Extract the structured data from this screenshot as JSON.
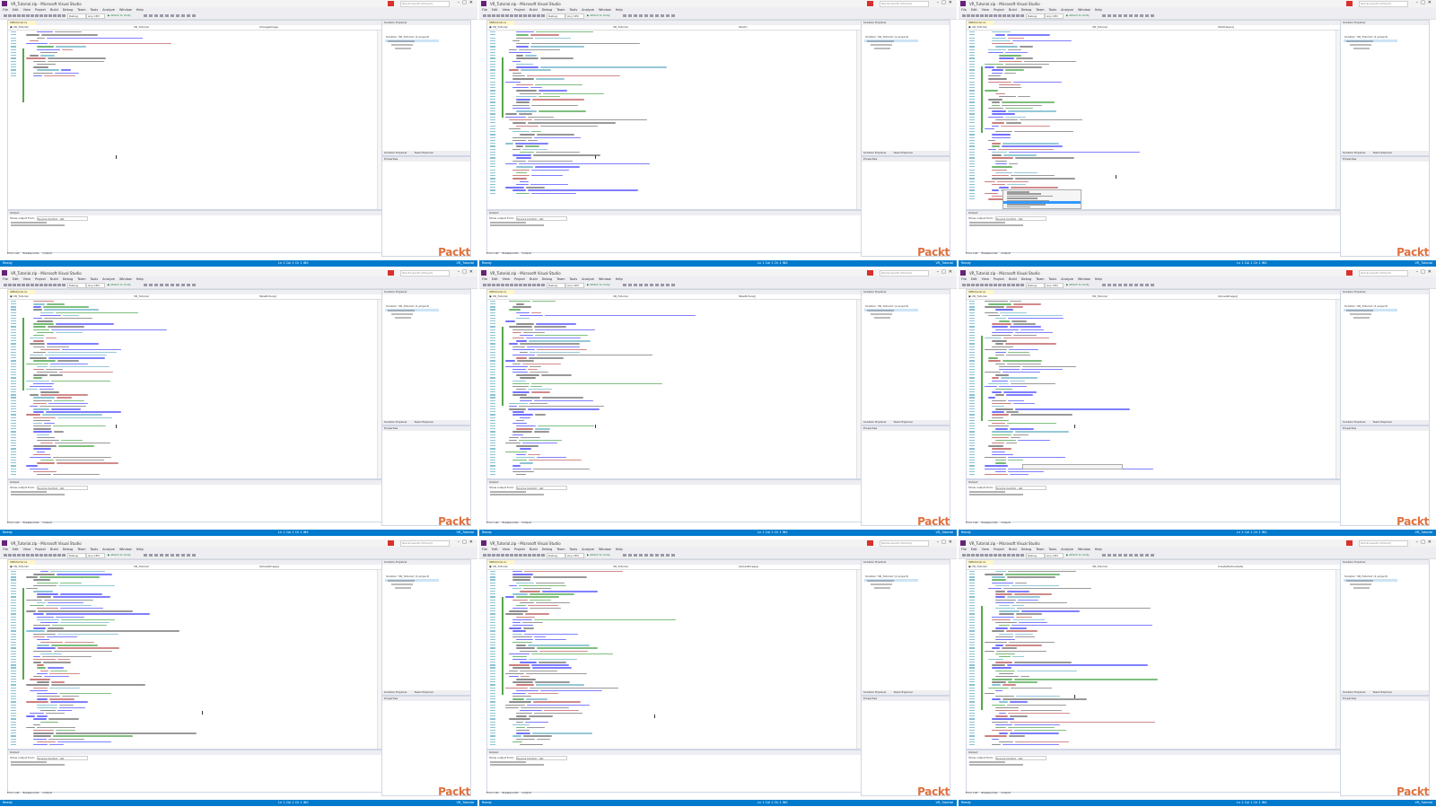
{
  "tiles": [
    {
      "title": "VR_Tutorial.zip - Microsoft Visual Studio",
      "tab": "VRTutorial.cs",
      "nav_class": "VR_Tutorial",
      "nav_member": "ChangeImage",
      "lines": 16
    },
    {
      "title": "VR_Tutorial.zip - Microsoft Visual Studio",
      "tab": "VRTutorial.cs",
      "nav_class": "VR_Tutorial",
      "nav_member": "Start()",
      "lines": 56
    },
    {
      "title": "VR_Tutorial.zip - Microsoft Visual Studio",
      "tab": "VRTutorial.cs",
      "nav_class": "VR_Tutorial",
      "nav_member": "StartUsers()",
      "lines": 58
    },
    {
      "title": "VR_Tutorial.zip - Microsoft Visual Studio",
      "tab": "VRTutorial.cs",
      "nav_class": "VR_Tutorial",
      "nav_member": "TakePicture()",
      "lines": 62
    },
    {
      "title": "VR_Tutorial.zip - Microsoft Visual Studio",
      "tab": "VRTutorial.cs",
      "nav_class": "VR_Tutorial",
      "nav_member": "TakePicture()",
      "lines": 62
    },
    {
      "title": "VR_Tutorial.zip - Microsoft Visual Studio",
      "tab": "VRTutorial.cs",
      "nav_class": "VR_Tutorial",
      "nav_member": "UploadImage()",
      "lines": 62
    },
    {
      "title": "VR_Tutorial.zip - Microsoft Visual Studio",
      "tab": "VRTutorial.cs",
      "nav_class": "VR_Tutorial",
      "nav_member": "UploadImage()",
      "lines": 62
    },
    {
      "title": "VR_Tutorial.zip - Microsoft Visual Studio",
      "tab": "VRTutorial.cs",
      "nav_class": "VR_Tutorial",
      "nav_member": "UploadImage()",
      "lines": 62
    },
    {
      "title": "VR_Tutorial.zip - Microsoft Visual Studio",
      "tab": "VRTutorial.cs",
      "nav_class": "VR_Tutorial",
      "nav_member": "CreateTextureSet()",
      "lines": 62
    }
  ],
  "common": {
    "search_placeholder": "Quick Launch (Ctrl+Q)",
    "menus": [
      "File",
      "Edit",
      "View",
      "Project",
      "Build",
      "Debug",
      "Team",
      "Tools",
      "Analyze",
      "Window",
      "Help"
    ],
    "config": "Debug",
    "platform": "Any CPU",
    "run_label": "Attach to Unity",
    "solution_header": "Solution Explorer",
    "solution_title": "Solution 'VR_Tutorial' (1 project)",
    "solution_tabs": [
      "Solution Explorer",
      "Team Explorer"
    ],
    "properties_header": "Properties",
    "output_header": "Output",
    "output_show": "Show output from:",
    "output_source": "Source Control - Git",
    "bottom_tabs": [
      "Error List",
      "Breakpoints",
      "Output"
    ],
    "status_ready": "Ready",
    "status_pos": "Ln 1   Col 1   Ch 1   INS",
    "status_right": "VR_Tutorial",
    "logo": "Packt",
    "accent": "#007acc",
    "logo_color": "#e0713f"
  }
}
